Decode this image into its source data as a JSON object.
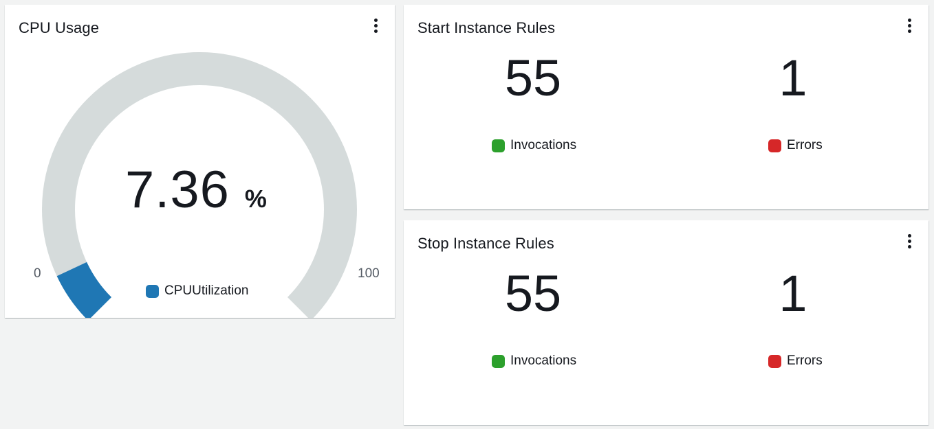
{
  "colors": {
    "gauge_track": "#d5dbdb",
    "gauge_fill": "#1f77b4",
    "invocations": "#2ca02c",
    "errors": "#d62728"
  },
  "cpu_widget": {
    "title": "CPU Usage",
    "menu_icon": "vertical-ellipsis-icon",
    "value": "7.36",
    "unit": "%",
    "value_fraction": 0.0736,
    "min_label": "0",
    "max_label": "100",
    "legend_label": "CPUUtilization"
  },
  "start_rules_widget": {
    "title": "Start Instance Rules",
    "menu_icon": "vertical-ellipsis-icon",
    "invocations_value": "55",
    "invocations_label": "Invocations",
    "errors_value": "1",
    "errors_label": "Errors"
  },
  "stop_rules_widget": {
    "title": "Stop Instance Rules",
    "menu_icon": "vertical-ellipsis-icon",
    "invocations_value": "55",
    "invocations_label": "Invocations",
    "errors_value": "1",
    "errors_label": "Errors"
  }
}
